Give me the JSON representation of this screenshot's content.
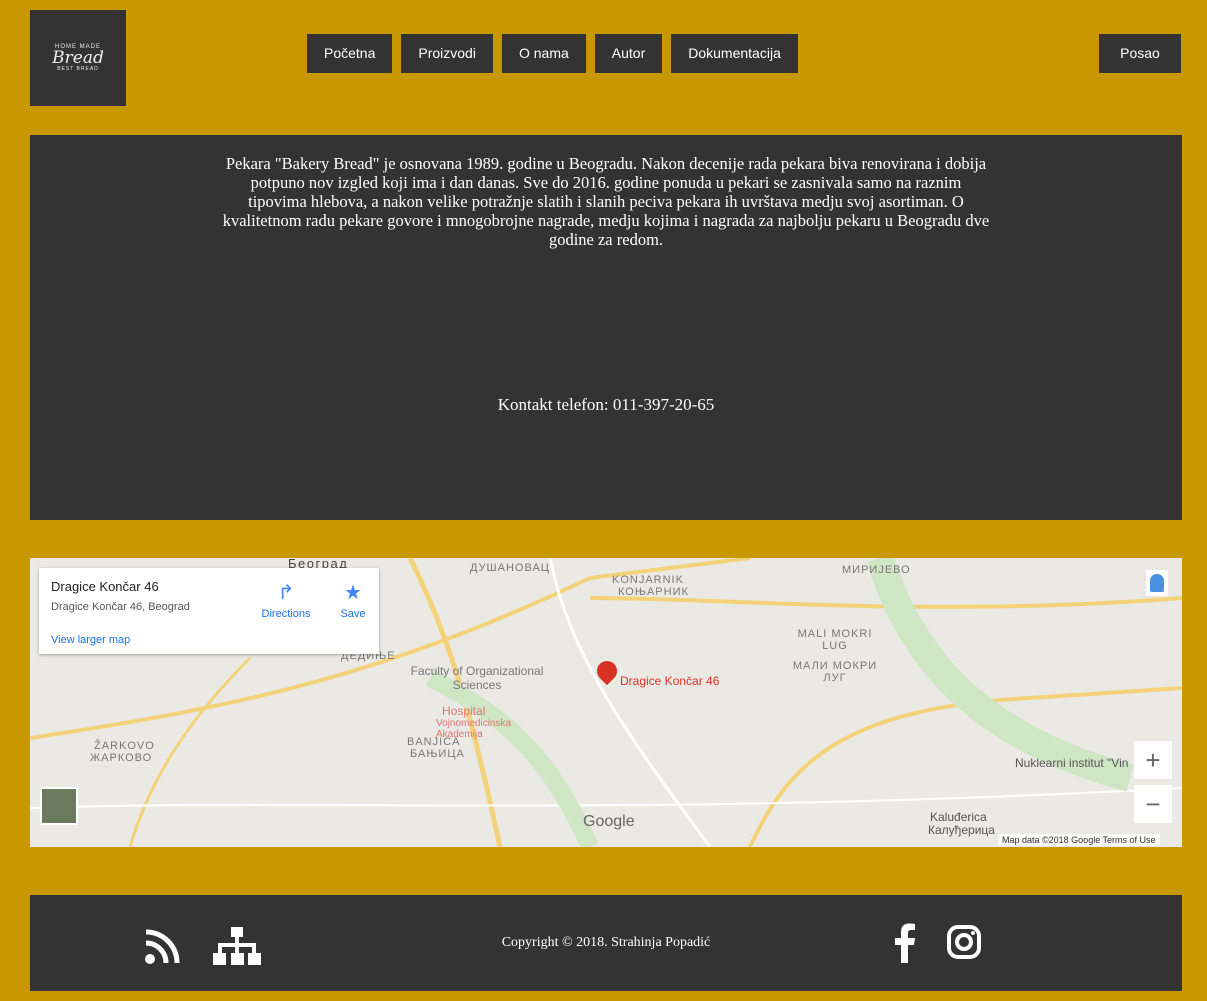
{
  "logo": {
    "top_text": "HOME MADE",
    "word": "Bread",
    "sub_text": "BEST BREAD"
  },
  "nav": {
    "items": [
      "Početna",
      "Proizvodi",
      "O nama",
      "Autor",
      "Dokumentacija"
    ],
    "right": "Posao"
  },
  "about": {
    "text": "Pekara \"Bakery Bread\" je osnovana 1989. godine u Beogradu. Nakon decenije rada pekara biva renovirana i dobija potpuno nov izgled koji ima i dan danas. Sve do 2016. godine ponuda u pekari se zasnivala samo na raznim tipovima hlebova, a nakon velike potražnje slatih i slanih peciva pekara ih uvrštava medju svoj asortiman. O kvalitetnom radu pekare govore i mnogobrojne nagrade, medju kojima i nagrada za najbolju pekaru u Beogradu dve godine za redom.",
    "phone": "Kontakt telefon: 011-397-20-65"
  },
  "map": {
    "place_title": "Dragice Končar 46",
    "place_address": "Dragice Končar 46, Beograd",
    "view_larger": "View larger map",
    "directions": "Directions",
    "save": "Save",
    "pin_label": "Dragice Končar 46",
    "labels": {
      "beograd": "Београд",
      "dushanovac": "ДУШАНОВАЦ",
      "konjarnik": "KONJARNIK",
      "konjarnik_cyr": "КОЊАРНИК",
      "mirijevo": "МИРИЈЕВО",
      "mali_mokri_lug": "MALI MOKRI LUG",
      "mali_mokri_lug_cyr": "МАЛИ МОКРИ ЛУГ",
      "faculty": "Faculty of Organizational Sciences",
      "hospital": "Hospital",
      "vma": "Vojnomedicinska Akademija",
      "banjica": "BANJICA",
      "banjica_cyr": "БАЊИЦА",
      "zarkovo": "ŽARKOVO",
      "zarkovo_cyr": "ЖАРКОВО",
      "nuklearni": "Nuklearni institut \"Vin",
      "kaludjerica": "Kaluđerica",
      "kaludjerica_cyr": "Калуђерица",
      "dedinje": "ДЕДИЊЕ"
    },
    "zoom_in": "+",
    "zoom_out": "−",
    "google": "Google",
    "attribution": "Map data ©2018 Google   Terms of Use"
  },
  "footer": {
    "copyright": "Copyright © 2018. Strahinja Popadić",
    "icons": [
      "rss-icon",
      "sitemap-icon",
      "facebook-icon",
      "instagram-icon"
    ]
  }
}
